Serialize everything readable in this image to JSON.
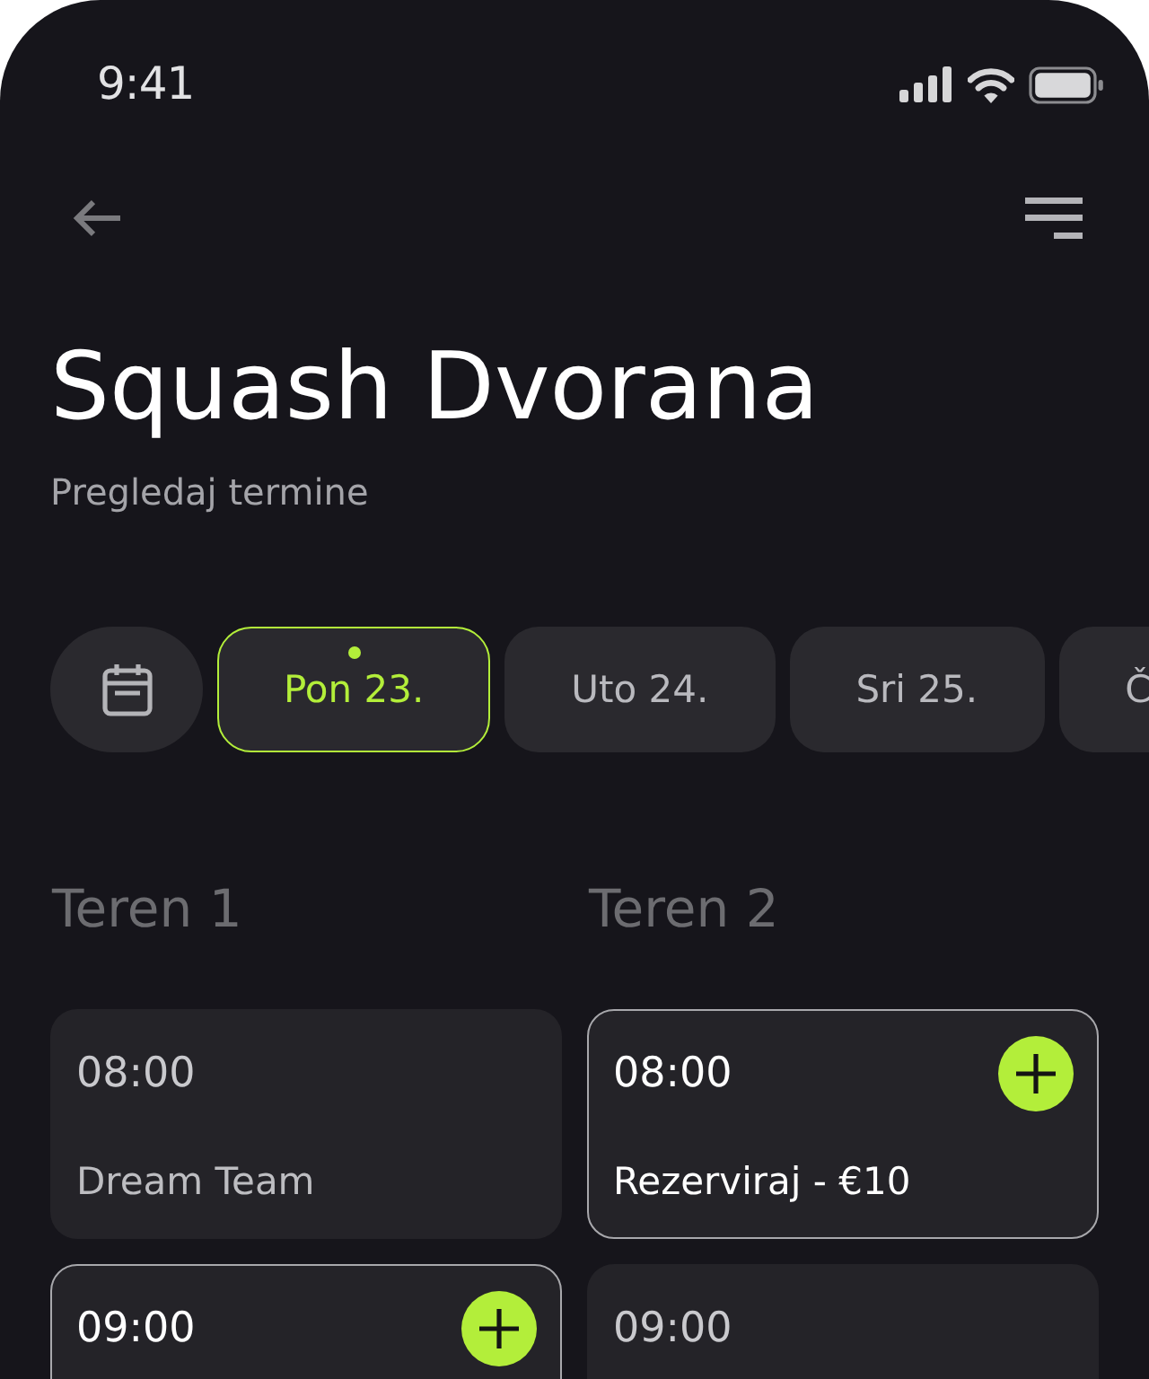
{
  "status_bar": {
    "time": "9:41"
  },
  "header": {
    "title": "Squash Dvorana",
    "subtitle": "Pregledaj termine"
  },
  "dates": [
    {
      "label": "Pon 23.",
      "selected": true
    },
    {
      "label": "Uto 24.",
      "selected": false
    },
    {
      "label": "Sri 25.",
      "selected": false
    },
    {
      "label": "Č",
      "selected": false
    }
  ],
  "courts": [
    {
      "name": "Teren 1",
      "slots": [
        {
          "time": "08:00",
          "label": "Dream Team",
          "available": false
        },
        {
          "time": "09:00",
          "available": true
        }
      ]
    },
    {
      "name": "Teren 2",
      "slots": [
        {
          "time": "08:00",
          "label": "Rezerviraj - €10",
          "available": true
        },
        {
          "time": "09:00",
          "available": false
        }
      ]
    }
  ]
}
